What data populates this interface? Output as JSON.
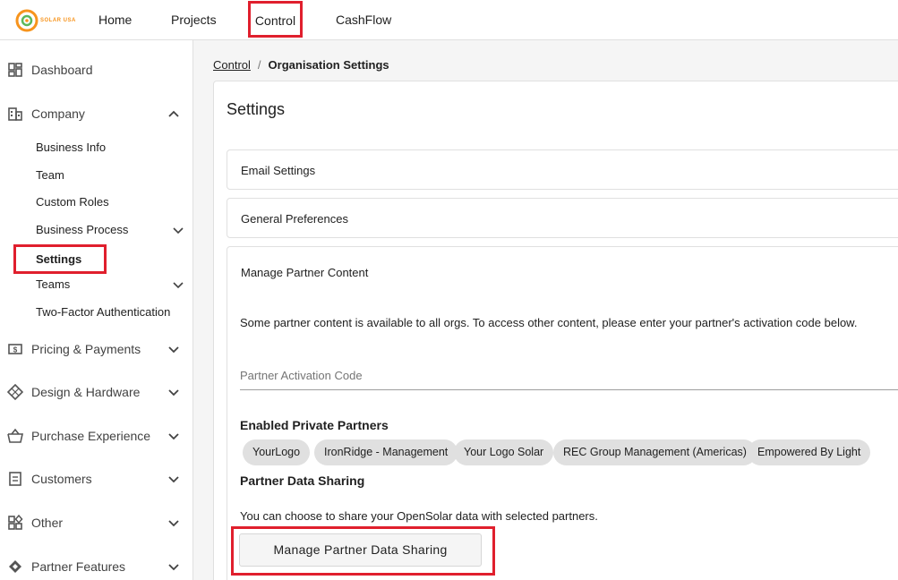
{
  "header": {
    "logo_text": "SOLAR USA",
    "nav": {
      "home": "Home",
      "projects": "Projects",
      "control": "Control",
      "cashflow": "CashFlow"
    }
  },
  "sidebar": {
    "dashboard": "Dashboard",
    "company": "Company",
    "company_items": {
      "business_info": "Business Info",
      "team": "Team",
      "custom_roles": "Custom Roles",
      "business_process": "Business Process",
      "settings": "Settings",
      "teams": "Teams",
      "two_factor": "Two-Factor Authentication"
    },
    "pricing": "Pricing & Payments",
    "design": "Design & Hardware",
    "purchase": "Purchase Experience",
    "customers": "Customers",
    "other": "Other",
    "partner_features": "Partner Features"
  },
  "breadcrumb": {
    "parent": "Control",
    "separator": "/",
    "current": "Organisation Settings"
  },
  "main": {
    "title": "Settings",
    "email_settings": "Email Settings",
    "general_preferences": "General Preferences",
    "partner_content": {
      "header": "Manage Partner Content",
      "description": "Some partner content is available to all orgs. To access other content, please enter your partner's activation code below.",
      "activation_placeholder": "Partner Activation Code",
      "enabled_heading": "Enabled Private Partners",
      "partners": [
        "YourLogo",
        "IronRidge - Management",
        "Your Logo Solar",
        "REC Group Management (Americas)",
        "Empowered By Light"
      ],
      "sharing_heading": "Partner Data Sharing",
      "sharing_description": "You can choose to share your OpenSolar data with selected partners.",
      "sharing_button": "Manage Partner Data Sharing"
    }
  },
  "colors": {
    "highlight": "#e01f2d",
    "logo_orange": "#f7941d",
    "logo_green": "#5cb85c"
  }
}
